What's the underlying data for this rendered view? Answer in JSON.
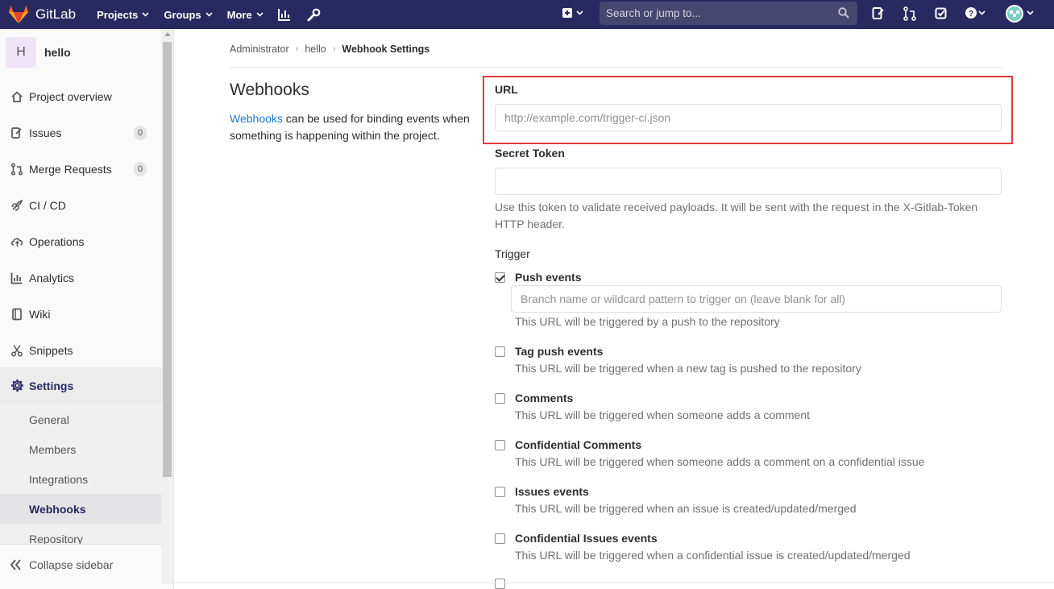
{
  "navbar": {
    "brand": "GitLab",
    "menu": [
      {
        "label": "Projects"
      },
      {
        "label": "Groups"
      },
      {
        "label": "More"
      }
    ],
    "search_placeholder": "Search or jump to..."
  },
  "sidebar": {
    "project_initial": "H",
    "project_name": "hello",
    "items": [
      {
        "label": "Project overview",
        "icon": "home-icon"
      },
      {
        "label": "Issues",
        "icon": "issues-icon",
        "badge": "0"
      },
      {
        "label": "Merge Requests",
        "icon": "merge-request-icon",
        "badge": "0"
      },
      {
        "label": "CI / CD",
        "icon": "rocket-icon"
      },
      {
        "label": "Operations",
        "icon": "cloud-icon"
      },
      {
        "label": "Analytics",
        "icon": "chart-icon"
      },
      {
        "label": "Wiki",
        "icon": "book-icon"
      },
      {
        "label": "Snippets",
        "icon": "scissors-icon"
      },
      {
        "label": "Settings",
        "icon": "gear-icon"
      }
    ],
    "settings_sub": [
      {
        "label": "General"
      },
      {
        "label": "Members"
      },
      {
        "label": "Integrations"
      },
      {
        "label": "Webhooks"
      },
      {
        "label": "Repository"
      }
    ],
    "collapse_label": "Collapse sidebar"
  },
  "breadcrumb": [
    "Administrator",
    "hello",
    "Webhook Settings"
  ],
  "intro": {
    "title": "Webhooks",
    "link": "Webhooks",
    "desc_rest": " can be used for binding events when something is happening within the project."
  },
  "form": {
    "url_label": "URL",
    "url_placeholder": "http://example.com/trigger-ci.json",
    "url_value": "",
    "token_label": "Secret Token",
    "token_value": "",
    "token_help": "Use this token to validate received payloads. It will be sent with the request in the X-Gitlab-Token HTTP header.",
    "trigger_label": "Trigger",
    "branch_placeholder": "Branch name or wildcard pattern to trigger on (leave blank for all)",
    "events": [
      {
        "label": "Push events",
        "help": "This URL will be triggered by a push to the repository",
        "checked": true
      },
      {
        "label": "Tag push events",
        "help": "This URL will be triggered when a new tag is pushed to the repository",
        "checked": false
      },
      {
        "label": "Comments",
        "help": "This URL will be triggered when someone adds a comment",
        "checked": false
      },
      {
        "label": "Confidential Comments",
        "help": "This URL will be triggered when someone adds a comment on a confidential issue",
        "checked": false
      },
      {
        "label": "Issues events",
        "help": "This URL will be triggered when an issue is created/updated/merged",
        "checked": false
      },
      {
        "label": "Confidential Issues events",
        "help": "This URL will be triggered when a confidential issue is created/updated/merged",
        "checked": false
      }
    ]
  },
  "colors": {
    "navbar": "#292961",
    "highlight": "#e03c3c",
    "link": "#1f78d1"
  }
}
